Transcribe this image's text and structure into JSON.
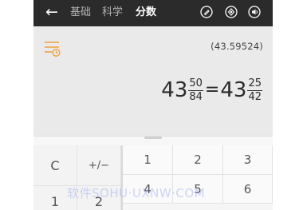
{
  "topbar": {
    "back_icon": "back-arrow-icon",
    "tabs": [
      {
        "label": "基础",
        "active": false
      },
      {
        "label": "科学",
        "active": false
      },
      {
        "label": "分数",
        "active": true
      }
    ],
    "icons": [
      "pen-icon",
      "settings-icon",
      "sound-icon"
    ],
    "background": "#2b2b2b"
  },
  "display": {
    "history_icon": "history-list-icon",
    "accent_color": "#f0a03c",
    "previous_result": "(43.59524)",
    "expression": {
      "left_whole": "43",
      "left_num": "50",
      "left_den": "84",
      "equals": "=",
      "right_whole": "43",
      "right_num": "25",
      "right_den": "42"
    }
  },
  "keypad": {
    "clear_label": "C",
    "sign_label": "+/−",
    "row1": [
      "1",
      "2",
      "3"
    ],
    "row2": [
      "4",
      "5",
      "6"
    ],
    "left_row2": [
      "1",
      "2"
    ]
  },
  "watermark": "软件SOHU·UXNW·COM"
}
